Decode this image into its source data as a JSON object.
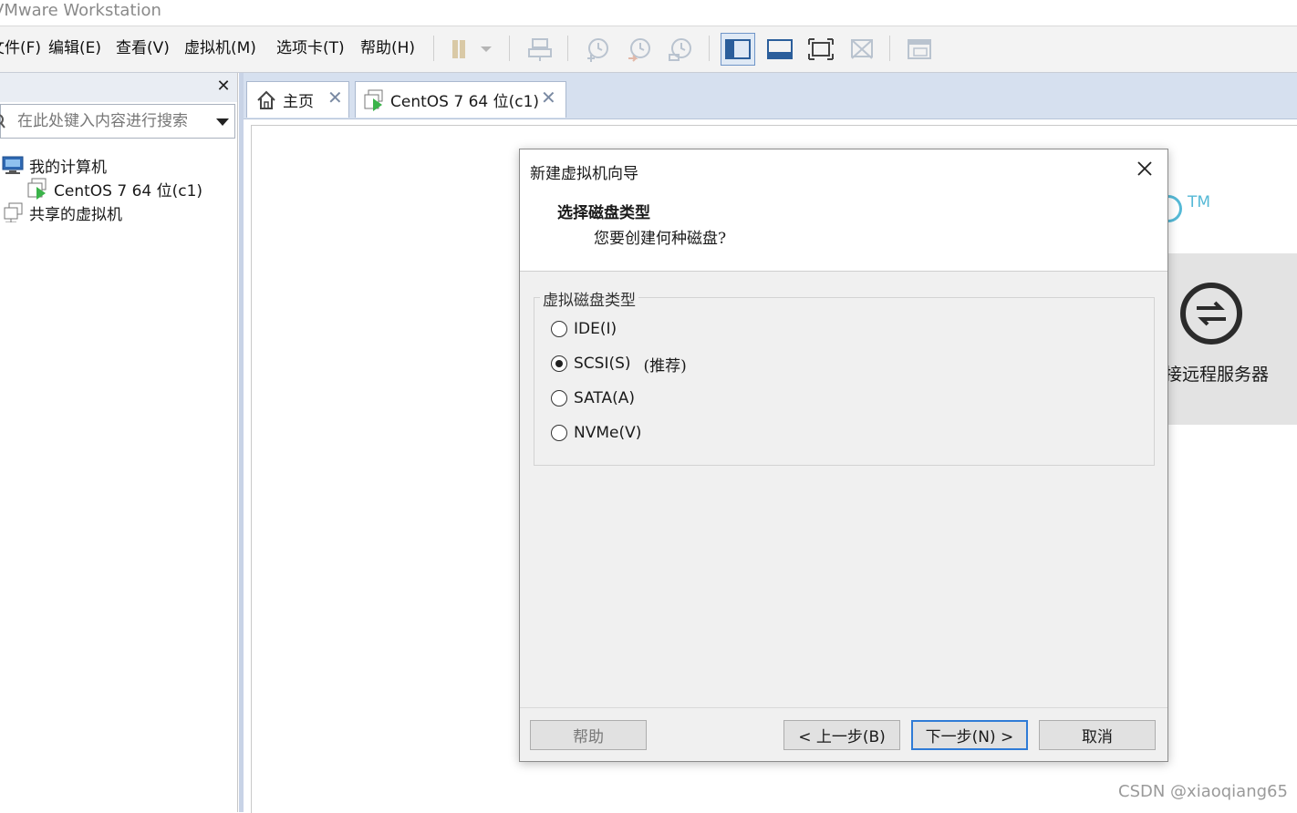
{
  "app": {
    "title": "VMware Workstation"
  },
  "menu": [
    "文件(F)",
    "编辑(E)",
    "查看(V)",
    "虚拟机(M)",
    "选项卡(T)",
    "帮助(H)"
  ],
  "library": {
    "search_placeholder": "在此处键入内容进行搜索",
    "tree": [
      {
        "label": "我的计算机"
      },
      {
        "label": "CentOS 7 64 位(c1)"
      },
      {
        "label": "共享的虚拟机"
      }
    ]
  },
  "tabs": [
    {
      "label": "主页"
    },
    {
      "label": "CentOS 7 64 位(c1)"
    }
  ],
  "home": {
    "tm": "TM",
    "remote_label": "连接远程服务器"
  },
  "dialog": {
    "title": "新建虚拟机向导",
    "heading": "选择磁盘类型",
    "subheading": "您要创建何种磁盘?",
    "group_label": "虚拟磁盘类型",
    "options": [
      {
        "label": "IDE(I)",
        "selected": false,
        "note": ""
      },
      {
        "label": "SCSI(S)",
        "selected": true,
        "note": "(推荐)"
      },
      {
        "label": "SATA(A)",
        "selected": false,
        "note": ""
      },
      {
        "label": "NVMe(V)",
        "selected": false,
        "note": ""
      }
    ],
    "buttons": {
      "help": "帮助",
      "back": "< 上一步(B)",
      "next": "下一步(N) >",
      "cancel": "取消"
    }
  },
  "watermark": "CSDN @xiaoqiang65",
  "colors": {
    "accent": "#2f7bd6",
    "tm": "#55b9d6",
    "vm_green": "#3bb34a"
  }
}
